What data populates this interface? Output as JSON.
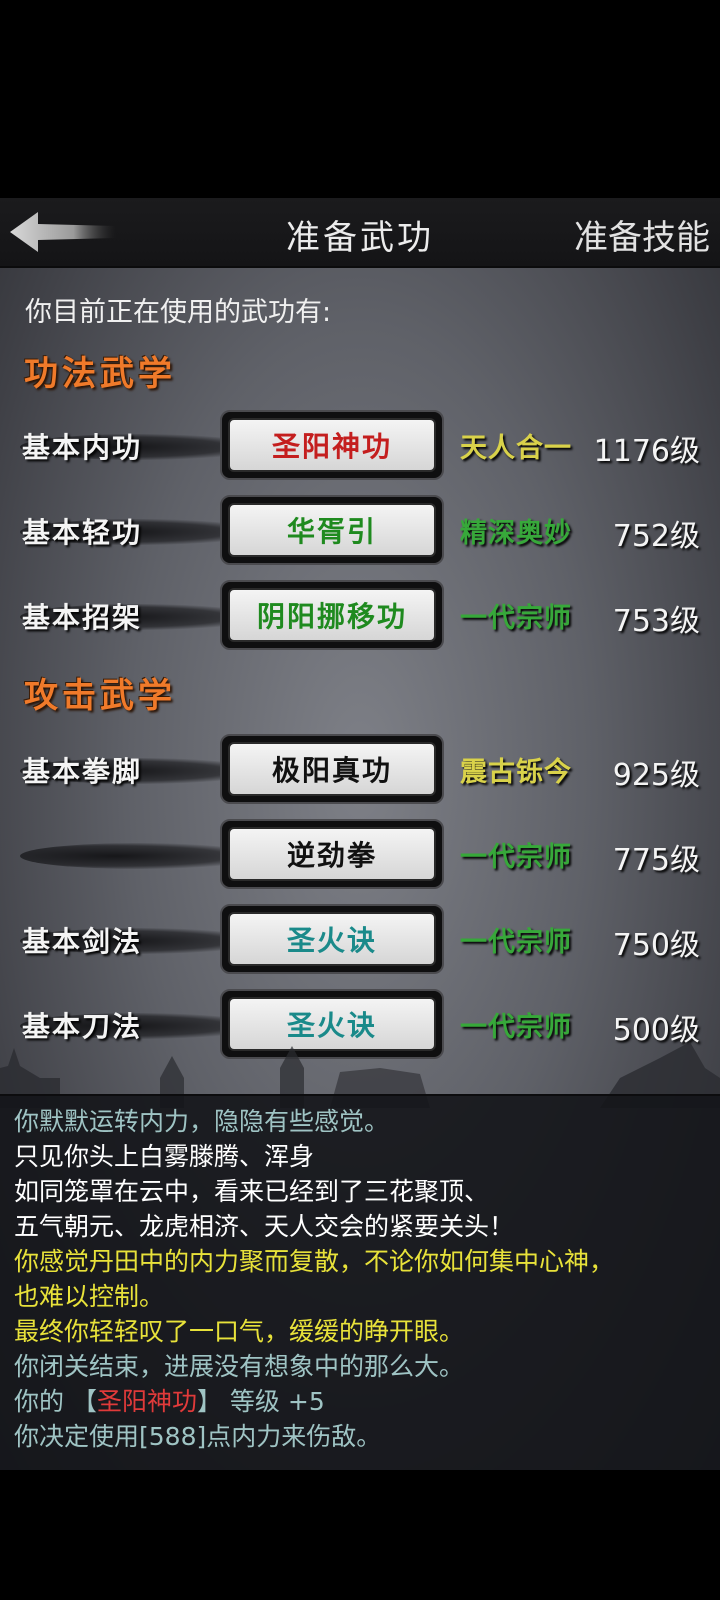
{
  "header": {
    "title": "准备武功",
    "right_tab": "准备技能",
    "back_icon": "back-arrow-icon"
  },
  "intro": "你目前正在使用的武功有:",
  "sections": [
    {
      "title": "功法武学",
      "rows": [
        {
          "label": "基本内功",
          "skill": "圣阳神功",
          "skill_color": "#c41e1e",
          "rank": "天人合一",
          "rank_color": "#d9d24a",
          "level": "1176级"
        },
        {
          "label": "基本轻功",
          "skill": "华胥引",
          "skill_color": "#1f8a1f",
          "rank": "精深奥妙",
          "rank_color": "#37a83a",
          "level": "752级"
        },
        {
          "label": "基本招架",
          "skill": "阴阳挪移功",
          "skill_color": "#1f8a1f",
          "rank": "一代宗师",
          "rank_color": "#37a83a",
          "level": "753级"
        }
      ]
    },
    {
      "title": "攻击武学",
      "rows": [
        {
          "label": "基本拳脚",
          "skill": "极阳真功",
          "skill_color": "#111111",
          "rank": "震古铄今",
          "rank_color": "#d9d24a",
          "level": "925级"
        },
        {
          "label": "",
          "skill": "逆劲拳",
          "skill_color": "#111111",
          "rank": "一代宗师",
          "rank_color": "#37a83a",
          "level": "775级"
        },
        {
          "label": "基本剑法",
          "skill": "圣火诀",
          "skill_color": "#1a8a8a",
          "rank": "一代宗师",
          "rank_color": "#37a83a",
          "level": "750级"
        },
        {
          "label": "基本刀法",
          "skill": "圣火诀",
          "skill_color": "#1a8a8a",
          "rank": "一代宗师",
          "rank_color": "#37a83a",
          "level": "500级"
        }
      ]
    }
  ],
  "log": [
    {
      "text": "你默默运转内力，隐隐有些感觉。",
      "color": "#9fc4c4"
    },
    {
      "text": "只见你头上白雾滕腾、浑身",
      "color": "#ffffff"
    },
    {
      "text": "如同笼罩在云中，看来已经到了三花聚顶、",
      "color": "#ffffff"
    },
    {
      "text": "五气朝元、龙虎相济、天人交会的紧要关头！",
      "color": "#ffffff"
    },
    {
      "text": "你感觉丹田中的内力聚而复散，不论你如何集中心神，",
      "color": "#e8e23a"
    },
    {
      "text": "也难以控制。",
      "color": "#e8e23a"
    },
    {
      "text": "最终你轻轻叹了一口气，缓缓的睁开眼。",
      "color": "#e8e23a"
    },
    {
      "text": "你闭关结束，进展没有想象中的那么大。",
      "color": "#9fc4c4"
    },
    {
      "parts": [
        {
          "text": "你的 ",
          "color": "#9fc4c4"
        },
        {
          "text": "【",
          "color": "#9fc4c4"
        },
        {
          "text": "圣阳神功",
          "color": "#e03a3a"
        },
        {
          "text": "】 等级 +5",
          "color": "#9fc4c4"
        }
      ]
    },
    {
      "text": "你决定使用[588]点内力来伤敌。",
      "color": "#9fc4c4"
    }
  ]
}
